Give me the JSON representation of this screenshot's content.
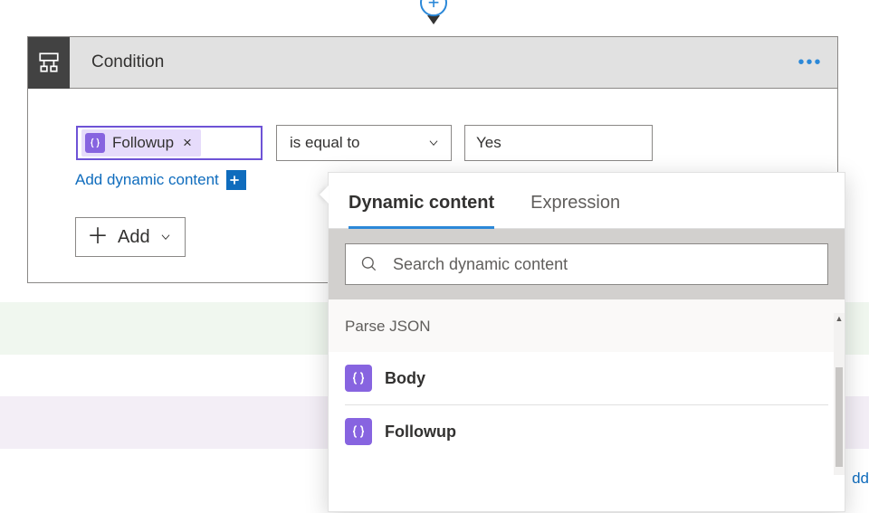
{
  "header": {
    "title": "Condition",
    "connector_arrow_plus": "+"
  },
  "condition": {
    "left_token": {
      "label": "Followup",
      "remove": "×"
    },
    "operator": "is equal to",
    "right_value": "Yes",
    "add_dynamic_link": "Add dynamic content",
    "add_button_label": "Add"
  },
  "flyout": {
    "tabs": {
      "dynamic": "Dynamic content",
      "expression": "Expression"
    },
    "search_placeholder": "Search dynamic content",
    "group": "Parse JSON",
    "items": [
      {
        "label": "Body"
      },
      {
        "label": "Followup"
      }
    ]
  },
  "overflow_link_fragment": "dd"
}
